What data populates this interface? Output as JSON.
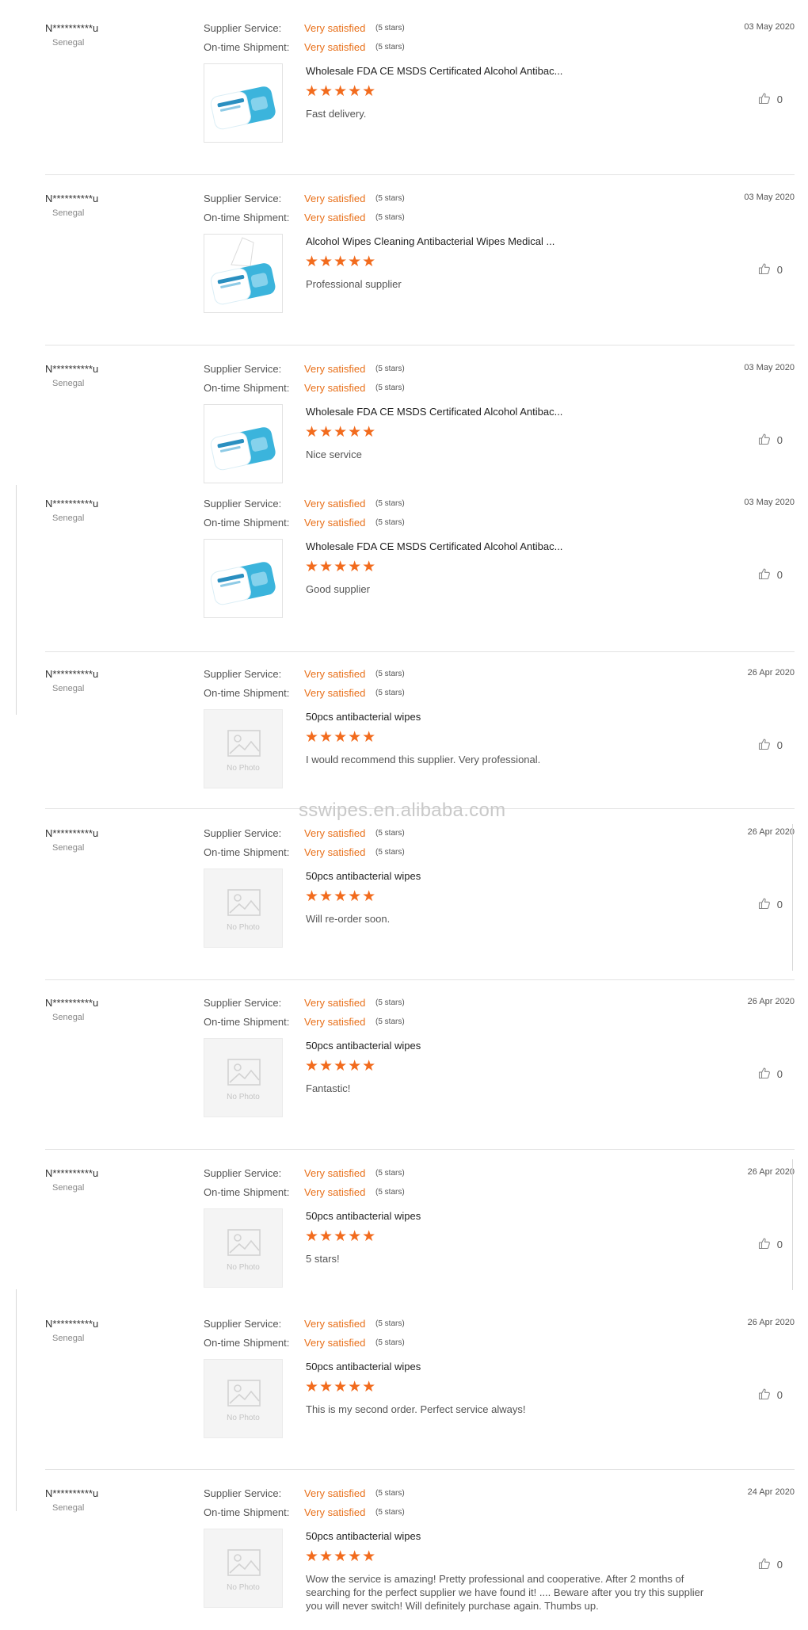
{
  "reviews": [
    {
      "buyer": "N**********u",
      "country": "Senegal",
      "date": "03 May 2020",
      "supplier_service_label": "Supplier Service:",
      "supplier_service_value": "Very satisfied",
      "supplier_service_stars": "(5 stars)",
      "shipment_label": "On-time Shipment:",
      "shipment_value": "Very satisfied",
      "shipment_stars": "(5 stars)",
      "product": "Wholesale FDA CE MSDS Certificated Alcohol Antibac...",
      "stars": "★★★★★",
      "comment": "Fast delivery.",
      "likes": "0",
      "photo": "wipes-pack"
    },
    {
      "buyer": "N**********u",
      "country": "Senegal",
      "date": "03 May 2020",
      "supplier_service_label": "Supplier Service:",
      "supplier_service_value": "Very satisfied",
      "supplier_service_stars": "(5 stars)",
      "shipment_label": "On-time Shipment:",
      "shipment_value": "Very satisfied",
      "shipment_stars": "(5 stars)",
      "product": "Alcohol Wipes Cleaning Antibacterial Wipes Medical ...",
      "stars": "★★★★★",
      "comment": "Professional supplier",
      "likes": "0",
      "photo": "wipes-pack-open"
    },
    {
      "buyer": "N**********u",
      "country": "Senegal",
      "date": "03 May 2020",
      "supplier_service_label": "Supplier Service:",
      "supplier_service_value": "Very satisfied",
      "supplier_service_stars": "(5 stars)",
      "shipment_label": "On-time Shipment:",
      "shipment_value": "Very satisfied",
      "shipment_stars": "(5 stars)",
      "product": "Wholesale FDA CE MSDS Certificated Alcohol Antibac...",
      "stars": "★★★★★",
      "comment": "Nice service",
      "likes": "0",
      "photo": "wipes-pack"
    },
    {
      "buyer": "N**********u",
      "country": "Senegal",
      "date": "03 May 2020",
      "supplier_service_label": "Supplier Service:",
      "supplier_service_value": "Very satisfied",
      "supplier_service_stars": "(5 stars)",
      "shipment_label": "On-time Shipment:",
      "shipment_value": "Very satisfied",
      "shipment_stars": "(5 stars)",
      "product": "Wholesale FDA CE MSDS Certificated Alcohol Antibac...",
      "stars": "★★★★★",
      "comment": "Good supplier",
      "likes": "0",
      "photo": "wipes-pack"
    },
    {
      "buyer": "N**********u",
      "country": "Senegal",
      "date": "26 Apr 2020",
      "supplier_service_label": "Supplier Service:",
      "supplier_service_value": "Very satisfied",
      "supplier_service_stars": "(5 stars)",
      "shipment_label": "On-time Shipment:",
      "shipment_value": "Very satisfied",
      "shipment_stars": "(5 stars)",
      "product": "50pcs antibacterial wipes",
      "stars": "★★★★★",
      "comment": "I would recommend this supplier. Very professional.",
      "likes": "0",
      "photo": "none",
      "no_photo_text": "No Photo"
    },
    {
      "buyer": "N**********u",
      "country": "Senegal",
      "date": "26 Apr 2020",
      "supplier_service_label": "Supplier Service:",
      "supplier_service_value": "Very satisfied",
      "supplier_service_stars": "(5 stars)",
      "shipment_label": "On-time Shipment:",
      "shipment_value": "Very satisfied",
      "shipment_stars": "(5 stars)",
      "product": "50pcs antibacterial wipes",
      "stars": "★★★★★",
      "comment": "Will re-order soon.",
      "likes": "0",
      "photo": "none",
      "no_photo_text": "No Photo"
    },
    {
      "buyer": "N**********u",
      "country": "Senegal",
      "date": "26 Apr 2020",
      "supplier_service_label": "Supplier Service:",
      "supplier_service_value": "Very satisfied",
      "supplier_service_stars": "(5 stars)",
      "shipment_label": "On-time Shipment:",
      "shipment_value": "Very satisfied",
      "shipment_stars": "(5 stars)",
      "product": "50pcs antibacterial wipes",
      "stars": "★★★★★",
      "comment": "Fantastic!",
      "likes": "0",
      "photo": "none",
      "no_photo_text": "No Photo"
    },
    {
      "buyer": "N**********u",
      "country": "Senegal",
      "date": "26 Apr 2020",
      "supplier_service_label": "Supplier Service:",
      "supplier_service_value": "Very satisfied",
      "supplier_service_stars": "(5 stars)",
      "shipment_label": "On-time Shipment:",
      "shipment_value": "Very satisfied",
      "shipment_stars": "(5 stars)",
      "product": "50pcs antibacterial wipes",
      "stars": "★★★★★",
      "comment": "5 stars!",
      "likes": "0",
      "photo": "none",
      "no_photo_text": "No Photo"
    },
    {
      "buyer": "N**********u",
      "country": "Senegal",
      "date": "26 Apr 2020",
      "supplier_service_label": "Supplier Service:",
      "supplier_service_value": "Very satisfied",
      "supplier_service_stars": "(5 stars)",
      "shipment_label": "On-time Shipment:",
      "shipment_value": "Very satisfied",
      "shipment_stars": "(5 stars)",
      "product": "50pcs antibacterial wipes",
      "stars": "★★★★★",
      "comment": "This is my second order. Perfect service always!",
      "likes": "0",
      "photo": "none",
      "no_photo_text": "No Photo"
    },
    {
      "buyer": "N**********u",
      "country": "Senegal",
      "date": "24 Apr 2020",
      "supplier_service_label": "Supplier Service:",
      "supplier_service_value": "Very satisfied",
      "supplier_service_stars": "(5 stars)",
      "shipment_label": "On-time Shipment:",
      "shipment_value": "Very satisfied",
      "shipment_stars": "(5 stars)",
      "product": "50pcs antibacterial wipes",
      "stars": "★★★★★",
      "comment": "Wow the service is amazing! Pretty professional and cooperative. After 2 months of searching for the perfect supplier we have found it! .... Beware after you try this supplier you will never switch! Will definitely purchase again. Thumbs up.",
      "likes": "0",
      "photo": "none",
      "no_photo_text": "No Photo"
    }
  ],
  "watermark": "sswipes.en.alibaba.com",
  "colors": {
    "accent": "#e8701a",
    "star": "#f26b1d",
    "separator": "#e3e3e3"
  }
}
